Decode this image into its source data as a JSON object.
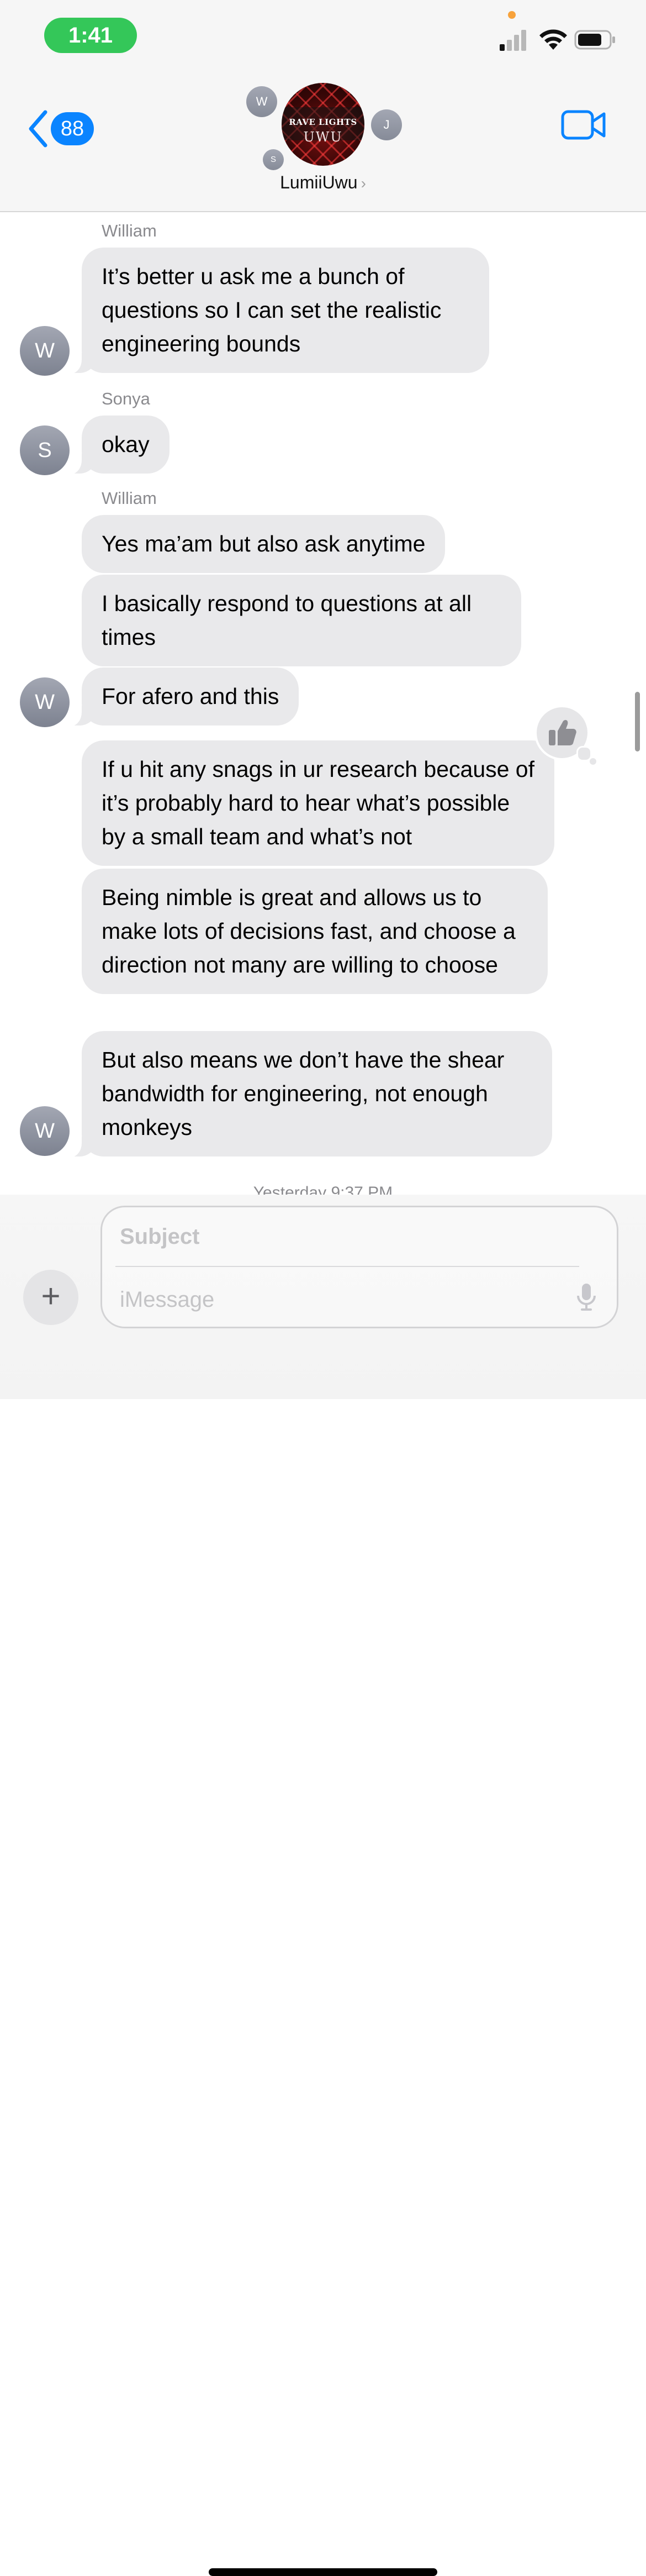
{
  "status_bar": {
    "time": "1:41",
    "colors": {
      "time_pill": "#34c759",
      "privacy_dot": "#f7a23b"
    },
    "icons": [
      "signal-icon",
      "wifi-icon",
      "battery-icon"
    ]
  },
  "header": {
    "unread_count": "88",
    "group_name": "LumiiUwu",
    "group_photo_text": {
      "line1": "RAVE LIGHTS",
      "line2": "UWU"
    },
    "member_initials": {
      "w": "W",
      "j": "J",
      "s": "S"
    },
    "accent_color": "#0a84ff",
    "icons": [
      "back-chevron-icon",
      "chevron-right-icon",
      "video-camera-icon"
    ]
  },
  "transcript": {
    "groups": [
      {
        "sender": "William",
        "initial": "W",
        "messages": [
          "It’s better u ask me a bunch of questions so I can set the realistic engineering bounds"
        ]
      },
      {
        "sender": "Sonya",
        "initial": "S",
        "messages": [
          "okay"
        ]
      },
      {
        "sender": "William",
        "initial": "W",
        "messages": [
          "Yes ma’am but also ask anytime",
          "I basically respond to questions at all times",
          "For afero and this"
        ]
      },
      {
        "sender": "",
        "initial": "W",
        "messages": [
          "If u hit any snags in ur research because of it’s probably hard to hear what’s possible by a small team and what’s not",
          "Being nimble is great and allows us to make lots of decisions fast, and choose a direction not many are willing to choose",
          "But also means we don’t have the shear bandwidth for engineering, not enough monkeys"
        ]
      }
    ],
    "tapback": {
      "icon": "thumbs-up-icon",
      "on_message": "If u hit any snags in ur research because of it’s probably hard to hear what’s possible by a small team and what’s not"
    },
    "timestamp": "Yesterday 9:37 PM",
    "bubble_color": "#e9e9eb"
  },
  "compose": {
    "subject_placeholder": "Subject",
    "message_placeholder": "iMessage",
    "subject_value": "",
    "message_value": "",
    "icons": [
      "plus-icon",
      "microphone-icon"
    ]
  }
}
